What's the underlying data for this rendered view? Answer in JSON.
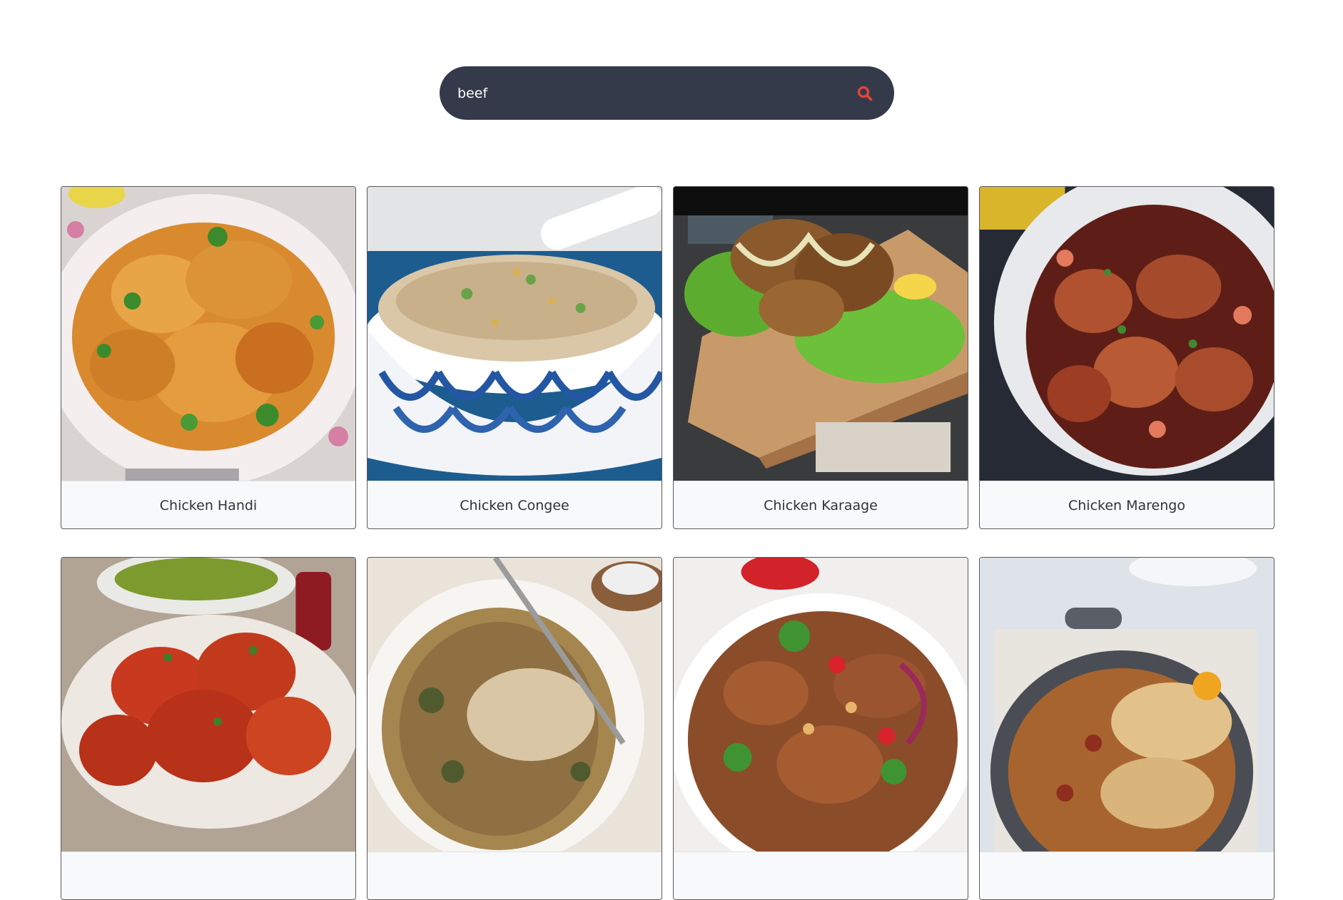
{
  "search": {
    "value": "beef",
    "icon": "search-icon",
    "icon_color": "#e8443a",
    "background": "#343a4a"
  },
  "meals": [
    {
      "title": "Chicken Handi"
    },
    {
      "title": "Chicken Congee"
    },
    {
      "title": "Chicken Karaage"
    },
    {
      "title": "Chicken Marengo"
    },
    {
      "title": ""
    },
    {
      "title": ""
    },
    {
      "title": ""
    },
    {
      "title": ""
    }
  ]
}
